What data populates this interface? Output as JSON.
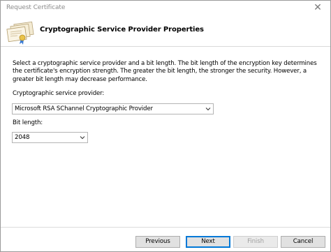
{
  "window": {
    "title": "Request Certificate",
    "close_glyph": "✕"
  },
  "header": {
    "title": "Cryptographic Service Provider Properties",
    "icon": "certificate-icon"
  },
  "main": {
    "description": "Select a cryptographic service provider and a bit length. The bit length of the encryption key determines the certificate's encryption strength. The greater the bit length, the stronger the security. However, a greater bit length may decrease performance.",
    "provider": {
      "label": "Cryptographic service provider:",
      "value": "Microsoft RSA SChannel Cryptographic Provider"
    },
    "bit_length": {
      "label": "Bit length:",
      "value": "2048"
    }
  },
  "footer": {
    "previous_label": "Previous",
    "next_label": "Next",
    "finish_label": "Finish",
    "cancel_label": "Cancel"
  },
  "colors": {
    "default_button_border": "#0078d7",
    "title_text": "#8a8a8a"
  }
}
